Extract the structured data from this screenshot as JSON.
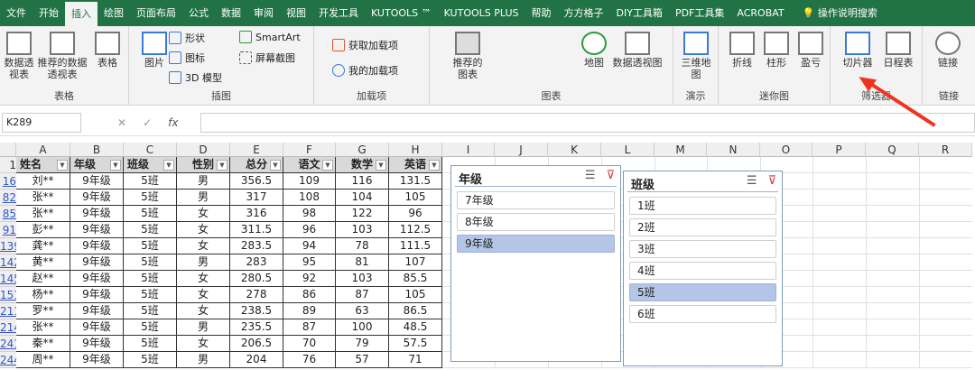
{
  "tabs": [
    "文件",
    "开始",
    "插入",
    "绘图",
    "页面布局",
    "公式",
    "数据",
    "审阅",
    "视图",
    "开发工具",
    "KUTOOLS ™",
    "KUTOOLS PLUS",
    "帮助",
    "方方格子",
    "DIY工具箱",
    "PDF工具集",
    "ACROBAT",
    "操作说明搜索"
  ],
  "active_tab": "插入",
  "ribbon": {
    "table_group": {
      "name": "表格",
      "pivot": "数据透视表",
      "recommended_pivot": "推荐的数据透视表",
      "table": "表格"
    },
    "illus_group": {
      "name": "插图",
      "picture": "图片",
      "shapes": "形状",
      "icons": "图标",
      "model3d": "3D 模型",
      "smartart": "SmartArt",
      "screenshot": "屏幕截图"
    },
    "addins_group": {
      "name": "加载项",
      "get": "获取加载项",
      "my": "我的加载项"
    },
    "charts_group": {
      "name": "图表",
      "recommended": "推荐的图表",
      "map": "地图",
      "pivotchart": "数据透视图"
    },
    "tour_group": {
      "name": "演示",
      "map3d": "三维地图"
    },
    "spark_group": {
      "name": "迷你图",
      "line": "折线",
      "column": "柱形",
      "winloss": "盈亏"
    },
    "filter_group": {
      "name": "筛选器",
      "slicer": "切片器",
      "timeline": "日程表"
    },
    "links_group": {
      "name": "链接",
      "link": "链接"
    }
  },
  "formula_bar": {
    "name_box": "K289",
    "fx": "fx",
    "value": ""
  },
  "columns": [
    "A",
    "B",
    "C",
    "D",
    "E",
    "F",
    "G",
    "H",
    "I",
    "J",
    "K",
    "L",
    "M",
    "N",
    "O",
    "P",
    "Q",
    "R"
  ],
  "table": {
    "header_row": "1",
    "headers": [
      "姓名",
      "年级",
      "班级",
      "性别",
      "总分",
      "语文",
      "数学",
      "英语"
    ],
    "filtered": [
      false,
      true,
      true,
      false,
      false,
      false,
      false,
      false
    ],
    "rows": [
      {
        "n": "16",
        "v": [
          "刘**",
          "9年级",
          "5班",
          "男",
          "356.5",
          "109",
          "116",
          "131.5"
        ]
      },
      {
        "n": "82",
        "v": [
          "张**",
          "9年级",
          "5班",
          "男",
          "317",
          "108",
          "104",
          "105"
        ]
      },
      {
        "n": "85",
        "v": [
          "张**",
          "9年级",
          "5班",
          "女",
          "316",
          "98",
          "122",
          "96"
        ]
      },
      {
        "n": "91",
        "v": [
          "彭**",
          "9年级",
          "5班",
          "女",
          "311.5",
          "96",
          "103",
          "112.5"
        ]
      },
      {
        "n": "139",
        "v": [
          "龚**",
          "9年级",
          "5班",
          "女",
          "283.5",
          "94",
          "78",
          "111.5"
        ]
      },
      {
        "n": "142",
        "v": [
          "黄**",
          "9年级",
          "5班",
          "男",
          "283",
          "95",
          "81",
          "107"
        ]
      },
      {
        "n": "145",
        "v": [
          "赵**",
          "9年级",
          "5班",
          "女",
          "280.5",
          "92",
          "103",
          "85.5"
        ]
      },
      {
        "n": "151",
        "v": [
          "杨**",
          "9年级",
          "5班",
          "女",
          "278",
          "86",
          "87",
          "105"
        ]
      },
      {
        "n": "211",
        "v": [
          "罗**",
          "9年级",
          "5班",
          "女",
          "238.5",
          "89",
          "63",
          "86.5"
        ]
      },
      {
        "n": "214",
        "v": [
          "张**",
          "9年级",
          "5班",
          "男",
          "235.5",
          "87",
          "100",
          "48.5"
        ]
      },
      {
        "n": "241",
        "v": [
          "秦**",
          "9年级",
          "5班",
          "女",
          "206.5",
          "70",
          "79",
          "57.5"
        ]
      },
      {
        "n": "244",
        "v": [
          "周**",
          "9年级",
          "5班",
          "男",
          "204",
          "76",
          "57",
          "71"
        ]
      }
    ]
  },
  "slicers": [
    {
      "title": "年级",
      "items": [
        "7年级",
        "8年级",
        "9年级"
      ],
      "selected": "9年级"
    },
    {
      "title": "班级",
      "items": [
        "1班",
        "2班",
        "3班",
        "4班",
        "5班",
        "6班"
      ],
      "selected": "5班"
    }
  ],
  "colors": {
    "brand": "#217346",
    "selected": "#b4c6e7",
    "arrow": "#ee3322"
  }
}
